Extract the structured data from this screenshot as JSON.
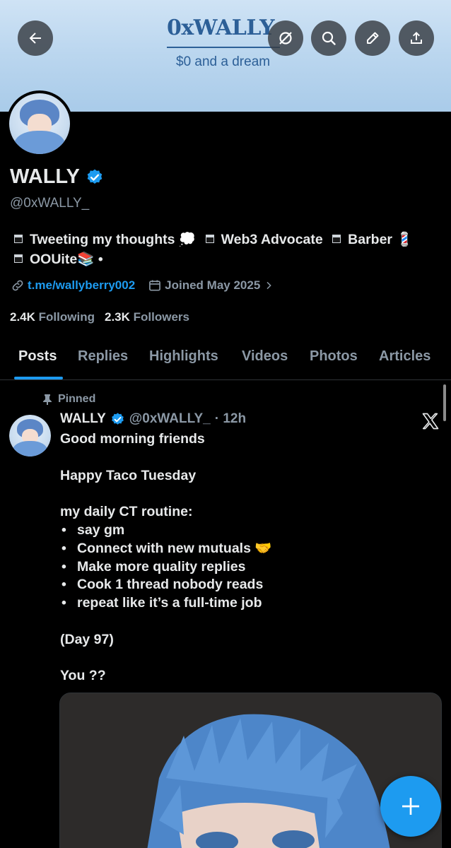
{
  "banner": {
    "title": "0xWALLY",
    "subtitle": "$0 and a dream"
  },
  "header_buttons": {
    "back_icon": "arrow-left-icon",
    "mute_icon": "mute-icon",
    "search_icon": "search-icon",
    "edit_icon": "pencil-icon",
    "share_icon": "share-icon"
  },
  "profile": {
    "display_name": "WALLY",
    "handle": "@0xWALLY_",
    "bio_line1": [
      "Tweeting my thoughts 💭",
      "Web3 Advocate",
      "Barber 💈"
    ],
    "bio_line2": "OOUite📚 •",
    "link": "t.me/wallyberry002",
    "joined": "Joined May 2025",
    "following_count": "2.4K",
    "following_label": "Following",
    "followers_count": "2.3K",
    "followers_label": "Followers"
  },
  "tabs": [
    "Posts",
    "Replies",
    "Highlights",
    "Videos",
    "Photos",
    "Articles"
  ],
  "active_tab": "Posts",
  "post": {
    "pinned_label": "Pinned",
    "author_name": "WALLY",
    "author_handle": "@0xWALLY_",
    "time": "· 12h",
    "lines": [
      "Good morning friends",
      "",
      "Happy Taco Tuesday",
      "",
      "my daily CT routine:"
    ],
    "bullets": [
      "say gm",
      "Connect with new mutuals 🤝",
      "Make more quality replies",
      "Cook 1 thread nobody reads",
      "repeat like it’s a full-time job"
    ],
    "after_lines": [
      "",
      "(Day 97)",
      "",
      "You ??"
    ]
  },
  "colors": {
    "accent": "#1d9bf0",
    "background": "#000000",
    "secondary_text": "#8b98a5",
    "banner_text": "#2c5f97"
  },
  "fab_icon": "plus-icon"
}
